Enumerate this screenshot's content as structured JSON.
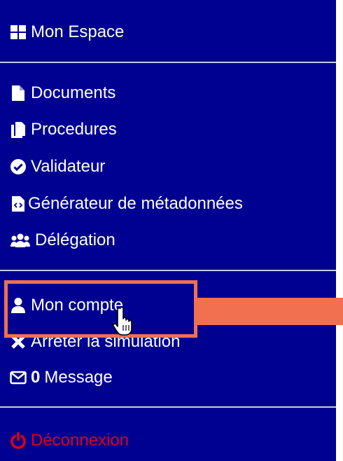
{
  "menu": {
    "workspace": {
      "label": "Mon Espace",
      "icon": "grid-icon"
    },
    "items": [
      {
        "label": "Documents",
        "icon": "file-icon"
      },
      {
        "label": "Procedures",
        "icon": "files-icon"
      },
      {
        "label": "Validateur",
        "icon": "check-circle-icon"
      },
      {
        "label": "Générateur de métadonnées",
        "icon": "code-file-icon"
      },
      {
        "label": "Délégation",
        "icon": "users-icon"
      }
    ],
    "account": {
      "label": "Mon compte",
      "icon": "user-icon"
    },
    "stop_simulation": {
      "label": "Arrêter la simulation",
      "icon": "x-icon"
    },
    "messages": {
      "count": "0",
      "label": "Message",
      "icon": "envelope-icon"
    },
    "logout": {
      "label": "Déconnexion",
      "icon": "power-icon"
    }
  },
  "colors": {
    "background": "#000091",
    "text": "#ffffff",
    "logout": "#e1000f",
    "highlight": "#f07050"
  }
}
